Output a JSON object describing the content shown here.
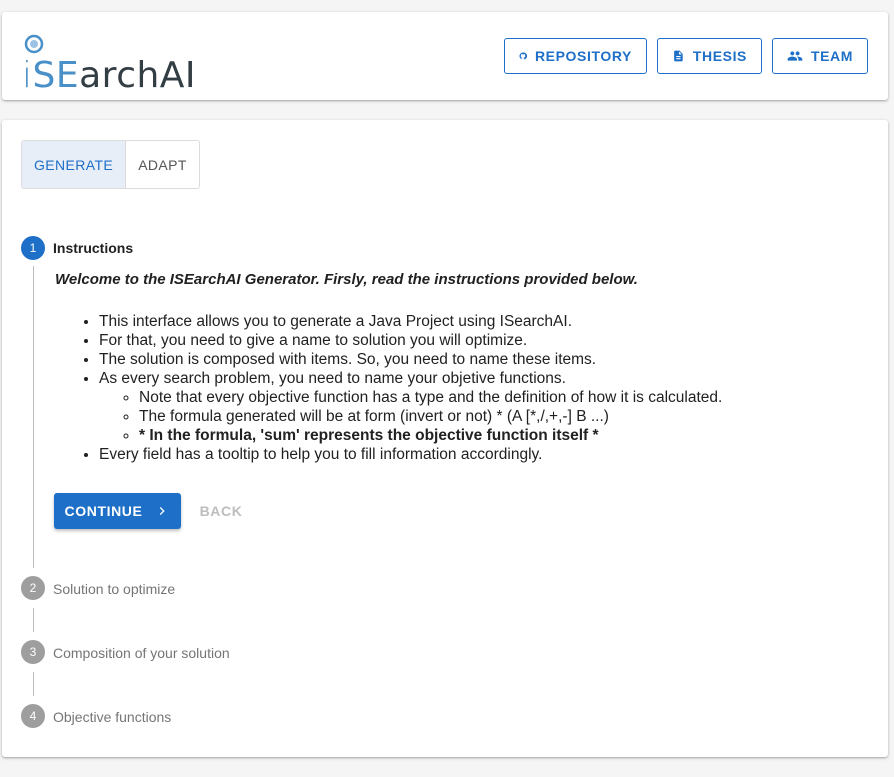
{
  "header": {
    "logo_text_i": "i",
    "logo_text_se": "SE",
    "logo_text_rest": "archAI",
    "buttons": [
      {
        "label": "REPOSITORY",
        "icon": "github-icon"
      },
      {
        "label": "THESIS",
        "icon": "document-icon"
      },
      {
        "label": "TEAM",
        "icon": "people-icon"
      }
    ]
  },
  "tabs": [
    {
      "label": "GENERATE",
      "active": true
    },
    {
      "label": "ADAPT",
      "active": false
    }
  ],
  "stepper": {
    "steps": [
      {
        "number": "1",
        "label": "Instructions",
        "active": true
      },
      {
        "number": "2",
        "label": "Solution to optimize",
        "active": false
      },
      {
        "number": "3",
        "label": "Composition of your solution",
        "active": false
      },
      {
        "number": "4",
        "label": "Objective functions",
        "active": false
      }
    ],
    "intro": "Welcome to the ISEarchAI Generator. Firsly, read the instructions provided below.",
    "bullets": [
      "This interface allows you to generate a Java Project using ISearchAI.",
      "For that, you need to give a name to solution you will optimize.",
      "The solution is composed with items. So, you need to name these items.",
      "As every search problem, you need to name your objetive functions.",
      "Every field has a tooltip to help you to fill information accordingly."
    ],
    "sub_bullets": [
      "Note that every objective function has a type and the definition of how it is calculated.",
      "The formula generated will be at form (invert or not) * (A [*,/,+,-] B ...)",
      "* In the formula, 'sum' represents the objective function itself *"
    ],
    "continue_label": "CONTINUE",
    "back_label": "BACK"
  },
  "colors": {
    "primary": "#1e6fc7",
    "inactive_step": "#9e9e9e",
    "disabled_text": "#bdbdbd"
  }
}
